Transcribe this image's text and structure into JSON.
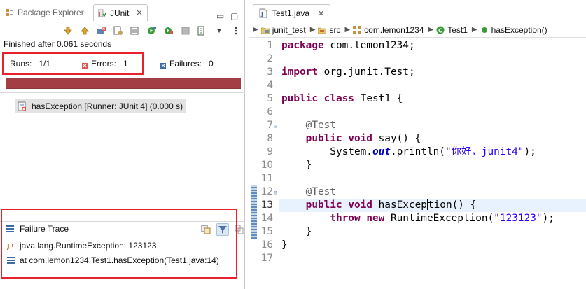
{
  "left": {
    "tabs": [
      {
        "label": "Package Explorer",
        "active": false
      },
      {
        "label": "JUnit",
        "active": true
      }
    ],
    "status": "Finished after 0.061 seconds",
    "counters": {
      "runs_label": "Runs:",
      "runs_value": "1/1",
      "errors_label": "Errors:",
      "errors_value": "1",
      "failures_label": "Failures:",
      "failures_value": "0"
    },
    "progress": {
      "fraction": 1.0,
      "color": "#a33f44"
    },
    "test_item": "hasException [Runner: JUnit 4] (0.000 s)",
    "failure_trace": {
      "title": "Failure Trace",
      "lines": [
        "java.lang.RuntimeException: 123123",
        "at com.lemon1234.Test1.hasException(Test1.java:14)"
      ]
    }
  },
  "editor": {
    "tab_label": "Test1.java",
    "breadcrumbs": [
      "junit_test",
      "src",
      "com.lemon1234",
      "Test1",
      "hasException()"
    ],
    "current_line": 13,
    "code_lines": [
      "package com.lemon1234;",
      "",
      "import org.junit.Test;",
      "",
      "public class Test1 {",
      "",
      "    @Test",
      "    public void say() {",
      "        System.out.println(\"你好，junit4\");",
      "    }",
      "",
      "    @Test",
      "    public void hasException() {",
      "        throw new RuntimeException(\"123123\");",
      "    }",
      "}",
      ""
    ]
  },
  "colors": {
    "highlight_box": "#e8212b",
    "keyword": "#7f0055",
    "string": "#2a00ff",
    "annotation": "#646464",
    "field": "#0000c0"
  }
}
